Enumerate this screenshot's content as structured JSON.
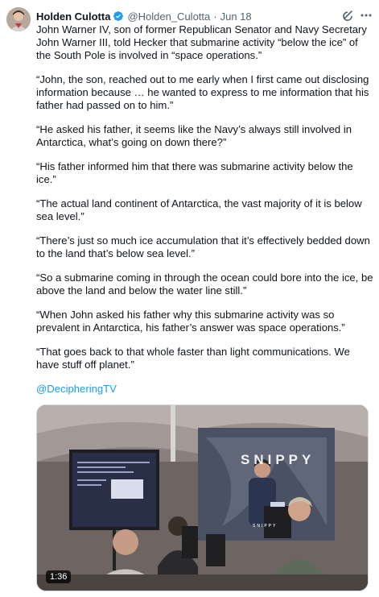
{
  "tweet": {
    "author_name": "Holden Culotta",
    "handle": "@Holden_Culotta",
    "separator": "·",
    "date": "Jun 18",
    "paragraphs": [
      "John Warner IV, son of former Republican Senator and Navy Secretary John Warner III, told Hecker that submarine activity “below the ice” of the South Pole is involved in “space operations.”",
      "“John, the son, reached out to me early when I first came out disclosing information because … he wanted to express to me information that his father had passed on to him.”",
      "“He asked his father, it seems like the Navy’s always still involved in Antarctica, what’s going on down there?”",
      "“His father informed him that there was submarine activity below the ice.”",
      "“The actual land continent of Antarctica, the vast majority of it is below sea level.”",
      "“There’s just so much ice accumulation that it’s effectively bedded down to the land that’s below sea level.”",
      "“So a submarine coming in through the ocean could bore into the ice, be above the land and below the water line still.”",
      "“When John asked his father why this submarine activity was so prevalent in Antarctica, his father’s answer was space operations.”",
      "“That goes back to that whole faster than light communications. We have stuff off planet.”"
    ],
    "mention": "@DecipheringTV"
  },
  "media": {
    "duration": "1:36",
    "banner_text": "SNIPPY",
    "banner_subtext": "SNIPPY"
  },
  "colors": {
    "text": "#0f1419",
    "secondary": "#536471",
    "link": "#1d9bf0",
    "verified": "#1d9bf0"
  },
  "icons": {
    "verified": "verified-badge-icon",
    "grok": "grok-icon",
    "more": "more-icon"
  }
}
